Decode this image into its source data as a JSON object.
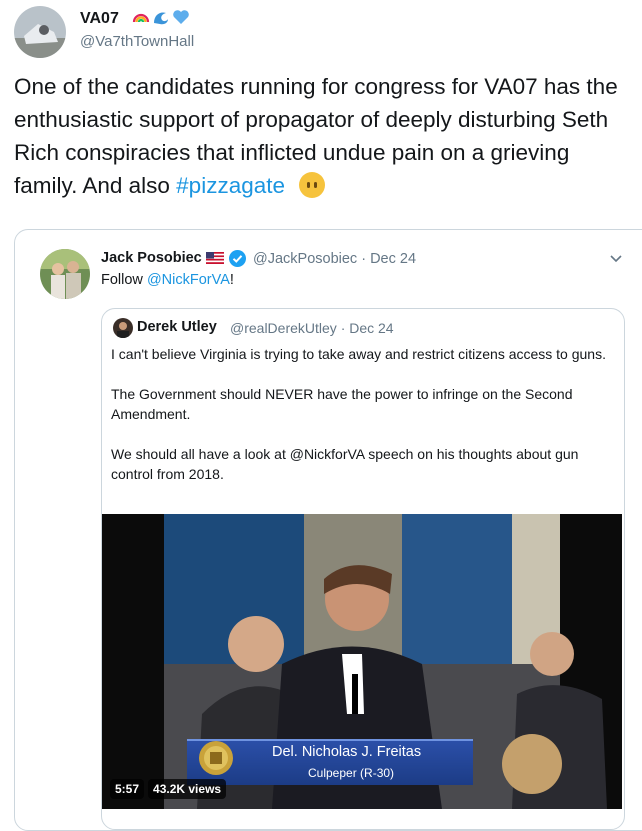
{
  "tweet": {
    "display_name": "VA07",
    "handle": "@Va7thTownHall",
    "name_emojis": [
      "rainbow-icon",
      "wave-icon",
      "blue-heart-icon"
    ],
    "text_before_hashtag": "One of the candidates running for congress for VA07 has the enthusiastic support of propagator of deeply disturbing Seth Rich conspiracies that inflicted undue pain on a grieving family. And also ",
    "hashtag": "#pizzagate",
    "trailing_emoji": "face-without-mouth-icon"
  },
  "quoted_tweet": {
    "display_name": "Jack Posobiec",
    "handle_and_date": "@JackPosobiec · Dec 24",
    "text_prefix": "Follow ",
    "mention": "@NickForVA",
    "text_suffix": "!",
    "colors": {
      "link": "#1b95e0",
      "verified": "#1da1f2"
    }
  },
  "nested_quote": {
    "display_name": "Derek Utley",
    "handle_and_date": "@realDerekUtley · Dec 24",
    "paragraphs": [
      "I can't believe Virginia is trying to take away and restrict citizens access to guns.",
      "The Government should NEVER have the power to infringe on the Second Amendment.",
      "We should all have a look at @NickforVA speech on his thoughts about gun control from 2018."
    ]
  },
  "video": {
    "caption_name": "Del. Nicholas J. Freitas",
    "caption_district": "Culpeper (R-30)",
    "duration": "5:57",
    "views": "43.2K views"
  }
}
